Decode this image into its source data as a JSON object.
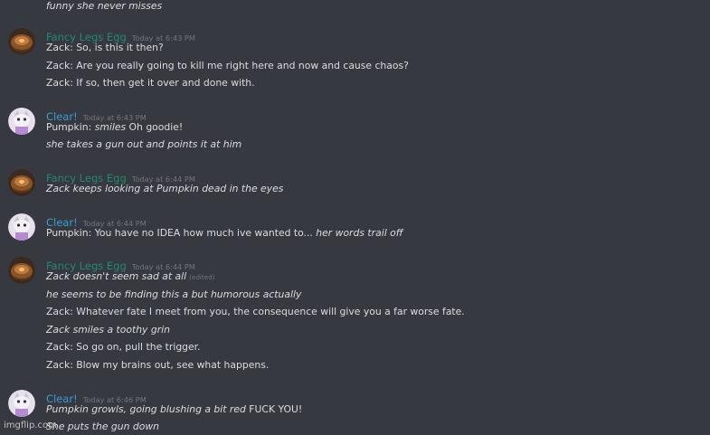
{
  "colors": {
    "background": "#36393f",
    "text": "#dcddde",
    "timestamp": "#72767d",
    "fancy_name": "#1f8b6c",
    "clear_name": "#3a9bd8"
  },
  "top_partial": {
    "line1": "funny she never misses"
  },
  "msg1": {
    "username": "Fancy Legs Egg",
    "timestamp": "Today at 6:43 PM",
    "line1": "Zack: So, is this it then?",
    "line2": "Zack: Are you really going to kill me right here and now and cause chaos?",
    "line3": "Zack: If so, then get it over and done with."
  },
  "msg2": {
    "username": "Clear!",
    "timestamp": "Today at 6:43 PM",
    "line1_a": "Pumpkin: ",
    "line1_b": "smiles",
    "line1_c": " Oh goodie!",
    "line2": "she takes a gun out and points it at him"
  },
  "msg3": {
    "username": "Fancy Legs Egg",
    "timestamp": "Today at 6:44 PM",
    "line1": "Zack keeps looking at Pumpkin dead in the eyes"
  },
  "msg4": {
    "username": "Clear!",
    "timestamp": "Today at 6:44 PM",
    "line1_a": "Pumpkin: You have no IDEA how much ive wanted to... ",
    "line1_b": "her words trail off"
  },
  "msg5": {
    "username": "Fancy Legs Egg",
    "timestamp": "Today at 6:44 PM",
    "line1": "Zack doesn't seem sad at all",
    "line1_edited": "(edited)",
    "line2": "he seems to be finding this a but humorous actually",
    "line3": "Zack: Whatever fate I meet from you, the consequence will give you a far worse fate.",
    "line4": "Zack smiles a toothy grin",
    "line5": "Zack: So go on, pull the trigger.",
    "line6": "Zack: Blow my brains out, see what happens."
  },
  "msg6": {
    "username": "Clear!",
    "timestamp": "Today at 6:46 PM",
    "line1_a": "Pumpkin growls, going blushing a bit red",
    "line1_b": " FUCK YOU!",
    "line2": "She puts the gun down"
  },
  "watermark": "imgflip.com"
}
